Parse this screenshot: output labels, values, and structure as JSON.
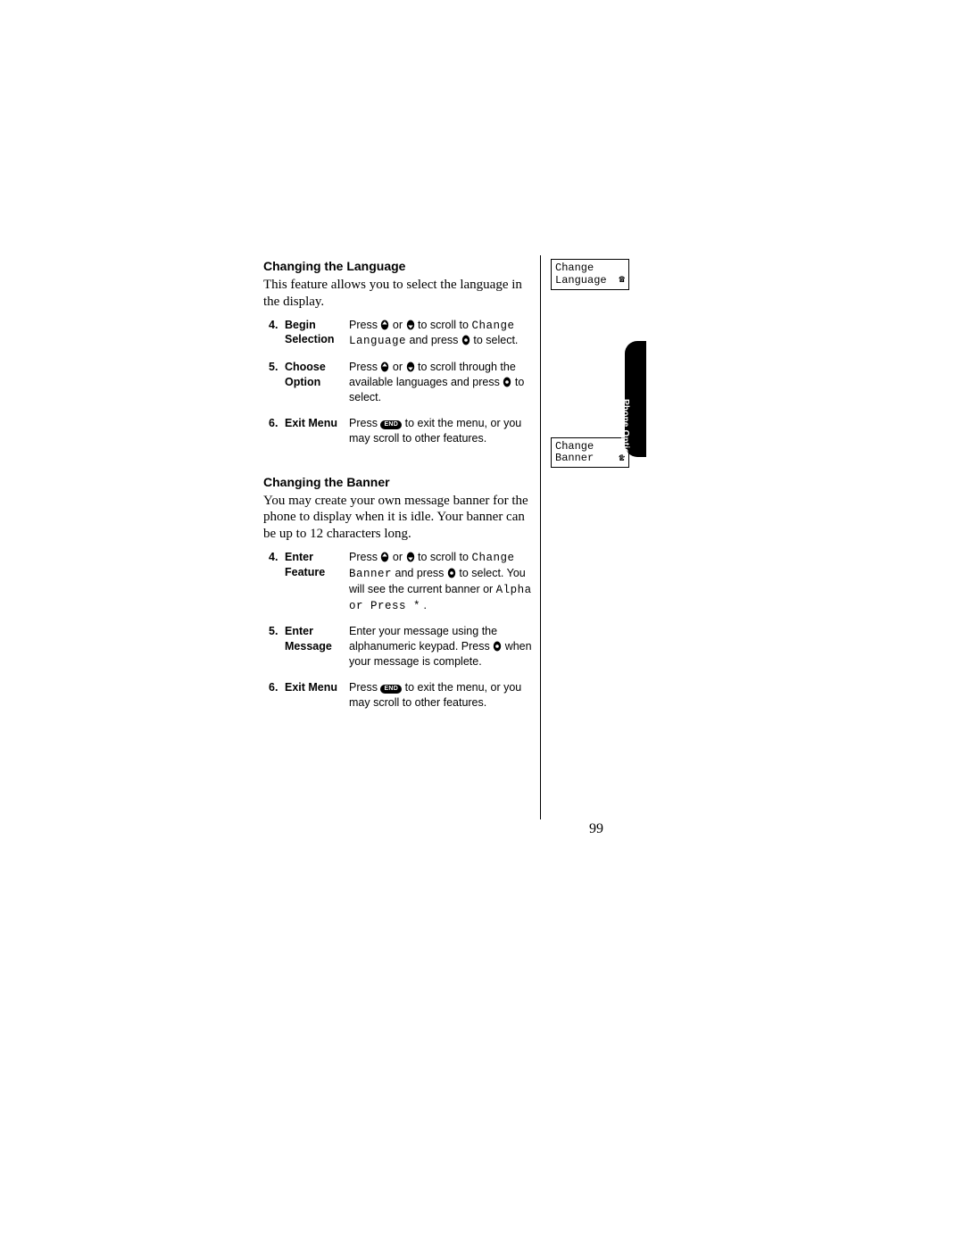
{
  "page_number": "99",
  "side_tab": "Phone Options",
  "sections": {
    "language": {
      "heading": "Changing the Language",
      "intro": "This feature allows you to select the language in the display.",
      "steps": [
        {
          "num": "4.",
          "label": "Begin Selection",
          "desc_pre": "Press ",
          "desc_mid1": " or ",
          "desc_mid2": " to scroll to ",
          "lcd": "Change Language",
          "desc_mid3": " and press ",
          "desc_post": " to select."
        },
        {
          "num": "5.",
          "label": "Choose Option",
          "desc_pre": "Press ",
          "desc_mid1": " or ",
          "desc_mid2": " to scroll through the available languages and press ",
          "desc_post": " to select."
        },
        {
          "num": "6.",
          "label": "Exit Menu",
          "desc_pre": "Press ",
          "desc_post": " to exit the menu, or you may scroll to other features."
        }
      ]
    },
    "banner": {
      "heading": "Changing the Banner",
      "intro": "You may create your own message banner for the phone to display when it is idle. Your banner can be up to 12 characters long.",
      "steps": [
        {
          "num": "4.",
          "label": "Enter Feature",
          "desc_pre": "Press ",
          "desc_mid1": " or ",
          "desc_mid2": " to scroll to ",
          "lcd1": "Change Banner",
          "desc_mid3": " and press ",
          "desc_mid4": " to select. You will see the current banner or ",
          "lcd2": "Alpha or Press *",
          "desc_post": "."
        },
        {
          "num": "5.",
          "label": "Enter Message",
          "desc_pre": "Enter your message using the alphanumeric keypad. Press ",
          "desc_post": " when your message is complete."
        },
        {
          "num": "6.",
          "label": "Exit Menu",
          "desc_pre": "Press ",
          "desc_post": " to exit the menu, or you may scroll to other features."
        }
      ]
    }
  },
  "screens": {
    "lang": {
      "line1": "Change",
      "line2": "Language"
    },
    "banner": {
      "line1": "Change",
      "line2": "Banner"
    }
  },
  "icons": {
    "up": "nav-up-icon",
    "down": "nav-down-icon",
    "select": "nav-select-icon",
    "end": "END",
    "phone": "☎"
  }
}
